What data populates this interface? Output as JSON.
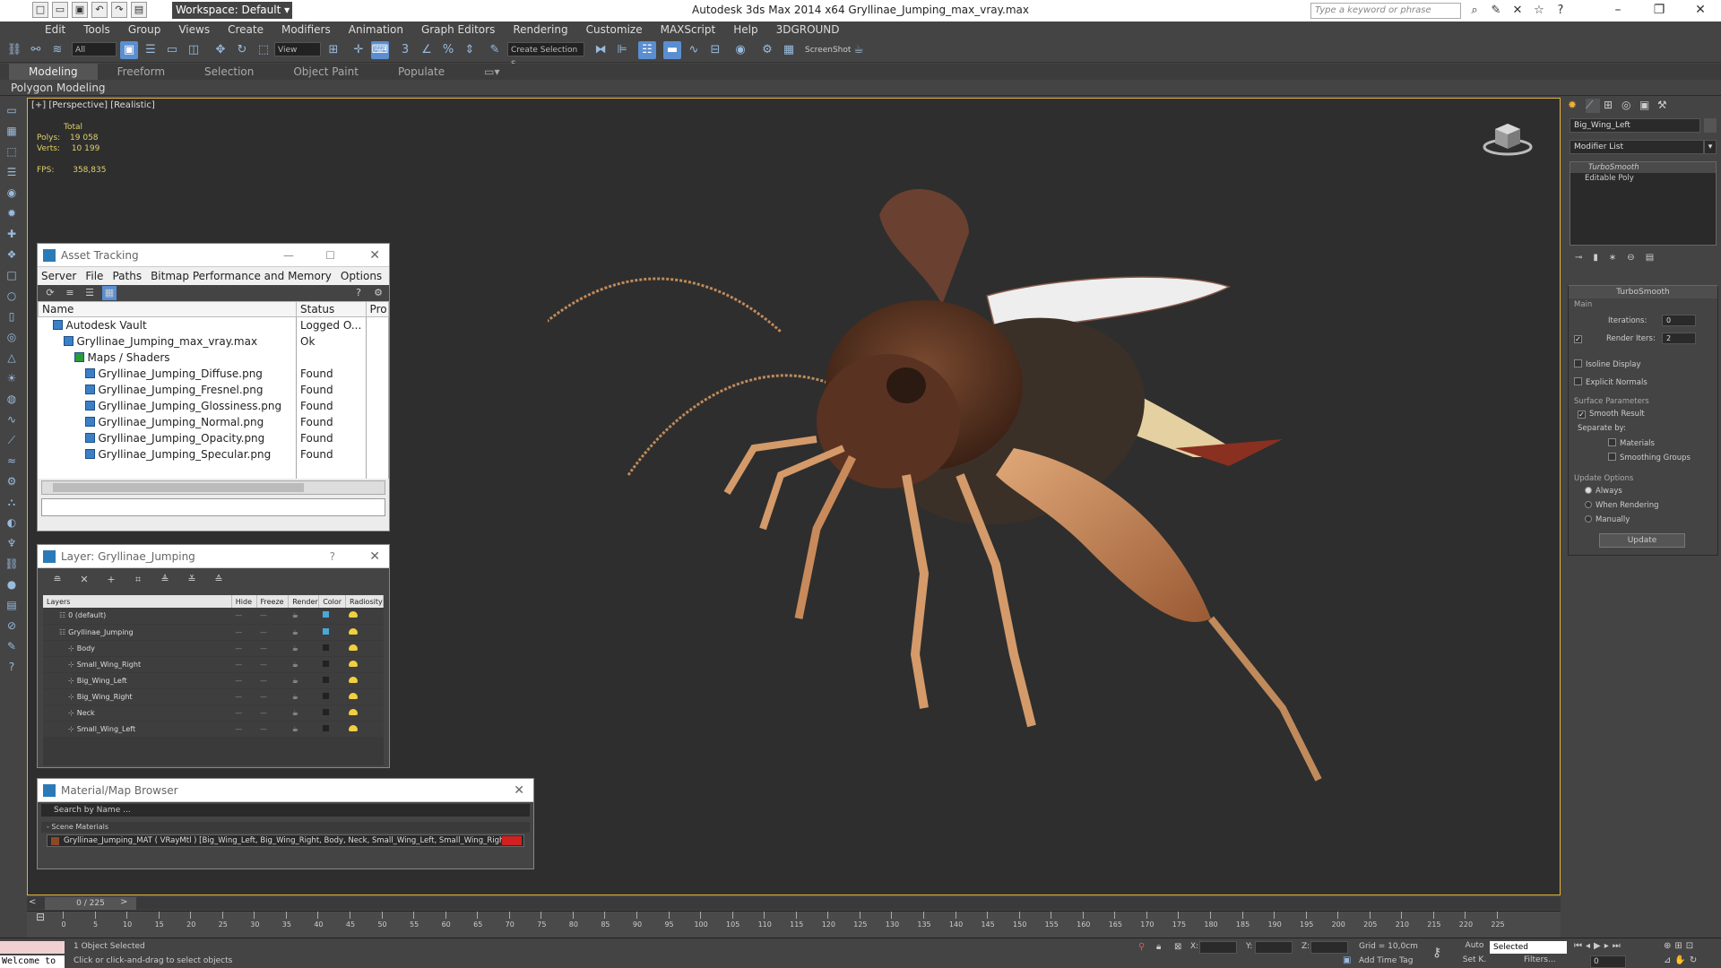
{
  "app": {
    "title": "Autodesk 3ds Max  2014 x64     Gryllinae_Jumping_max_vray.max",
    "workspace": "Workspace: Default",
    "search_placeholder": "Type a keyword or phrase"
  },
  "menu": [
    "Edit",
    "Tools",
    "Group",
    "Views",
    "Create",
    "Modifiers",
    "Animation",
    "Graph Editors",
    "Rendering",
    "Customize",
    "MAXScript",
    "Help",
    "3DGROUND"
  ],
  "toolbar": {
    "filter": "All",
    "refcoord": "View",
    "named_selection": "Create Selection S",
    "screenshot": "ScreenShot"
  },
  "ribbon": {
    "tabs": [
      "Modeling",
      "Freeform",
      "Selection",
      "Object Paint",
      "Populate"
    ],
    "active": "Modeling",
    "sub": "Polygon Modeling"
  },
  "viewport": {
    "label": "[+] [Perspective] [Realistic]",
    "stats_total": "Total",
    "polys_label": "Polys:",
    "polys": "19 058",
    "verts_label": "Verts:",
    "verts": "10 199",
    "fps_label": "FPS:",
    "fps": "358,835"
  },
  "asset_tracking": {
    "title": "Asset Tracking",
    "menu": [
      "Server",
      "File",
      "Paths",
      "Bitmap Performance and Memory",
      "Options"
    ],
    "columns": [
      "Name",
      "Status",
      "Pro"
    ],
    "rows": [
      {
        "name": "Autodesk Vault",
        "status": "Logged O...",
        "indent": 1
      },
      {
        "name": "Gryllinae_Jumping_max_vray.max",
        "status": "Ok",
        "indent": 2
      },
      {
        "name": "Maps / Shaders",
        "status": "",
        "indent": 3
      },
      {
        "name": "Gryllinae_Jumping_Diffuse.png",
        "status": "Found",
        "indent": 4
      },
      {
        "name": "Gryllinae_Jumping_Fresnel.png",
        "status": "Found",
        "indent": 4
      },
      {
        "name": "Gryllinae_Jumping_Glossiness.png",
        "status": "Found",
        "indent": 4
      },
      {
        "name": "Gryllinae_Jumping_Normal.png",
        "status": "Found",
        "indent": 4
      },
      {
        "name": "Gryllinae_Jumping_Opacity.png",
        "status": "Found",
        "indent": 4
      },
      {
        "name": "Gryllinae_Jumping_Specular.png",
        "status": "Found",
        "indent": 4
      }
    ]
  },
  "layer_panel": {
    "title": "Layer: Gryllinae_Jumping",
    "help": "?",
    "columns": [
      "Layers",
      "Hide",
      "Freeze",
      "Render",
      "Color",
      "Radiosity"
    ],
    "rows": [
      {
        "name": "0 (default)",
        "color": "#4aa8d8",
        "indent": 1
      },
      {
        "name": "Gryllinae_Jumping",
        "color": "#4aa8d8",
        "indent": 1
      },
      {
        "name": "Body",
        "color": "#222222",
        "indent": 2
      },
      {
        "name": "Small_Wing_Right",
        "color": "#222222",
        "indent": 2
      },
      {
        "name": "Big_Wing_Left",
        "color": "#222222",
        "indent": 2
      },
      {
        "name": "Big_Wing_Right",
        "color": "#222222",
        "indent": 2
      },
      {
        "name": "Neck",
        "color": "#222222",
        "indent": 2
      },
      {
        "name": "Small_Wing_Left",
        "color": "#222222",
        "indent": 2
      }
    ]
  },
  "material_browser": {
    "title": "Material/Map Browser",
    "search": "Search by Name ...",
    "section": "- Scene Materials",
    "item": "Gryllinae_Jumping_MAT ( VRayMtl ) [Big_Wing_Left, Big_Wing_Right, Body, Neck, Small_Wing_Left, Small_Wing_Right]"
  },
  "command_panel": {
    "object_name": "Big_Wing_Left",
    "modifier_list": "Modifier List",
    "stack": [
      "TurboSmooth",
      "Editable Poly"
    ],
    "rollout": "TurboSmooth",
    "main": "Main",
    "iterations_label": "Iterations:",
    "iterations": "0",
    "render_iters_label": "Render Iters:",
    "render_iters": "2",
    "isoline": "Isoline Display",
    "explicit": "Explicit Normals",
    "surface": "Surface Parameters",
    "smooth": "Smooth Result",
    "separate": "Separate by:",
    "materials": "Materials",
    "smoothing": "Smoothing Groups",
    "update_opts": "Update Options",
    "always": "Always",
    "when_rendering": "When Rendering",
    "manually": "Manually",
    "update_btn": "Update"
  },
  "timeline": {
    "frame": "0 / 225",
    "ticks": [
      "0",
      "5",
      "10",
      "15",
      "20",
      "25",
      "30",
      "35",
      "40",
      "45",
      "50",
      "55",
      "60",
      "65",
      "70",
      "75",
      "80",
      "85",
      "90",
      "95",
      "100",
      "105",
      "110",
      "115",
      "120",
      "125",
      "130",
      "135",
      "140",
      "145",
      "150",
      "155",
      "160",
      "165",
      "170",
      "175",
      "180",
      "185",
      "190",
      "195",
      "200",
      "205",
      "210",
      "215",
      "220",
      "225"
    ]
  },
  "status": {
    "welcome": "Welcome to",
    "selected": "1 Object Selected",
    "prompt": "Click or click-and-drag to select objects",
    "x_label": "X:",
    "y_label": "Y:",
    "z_label": "Z:",
    "grid": "Grid = 10,0cm",
    "add_time_tag": "Add Time Tag",
    "auto": "Auto",
    "setk": "Set K.",
    "key_mode": "Selected",
    "filters": "Filters...",
    "frame_val": "0"
  }
}
